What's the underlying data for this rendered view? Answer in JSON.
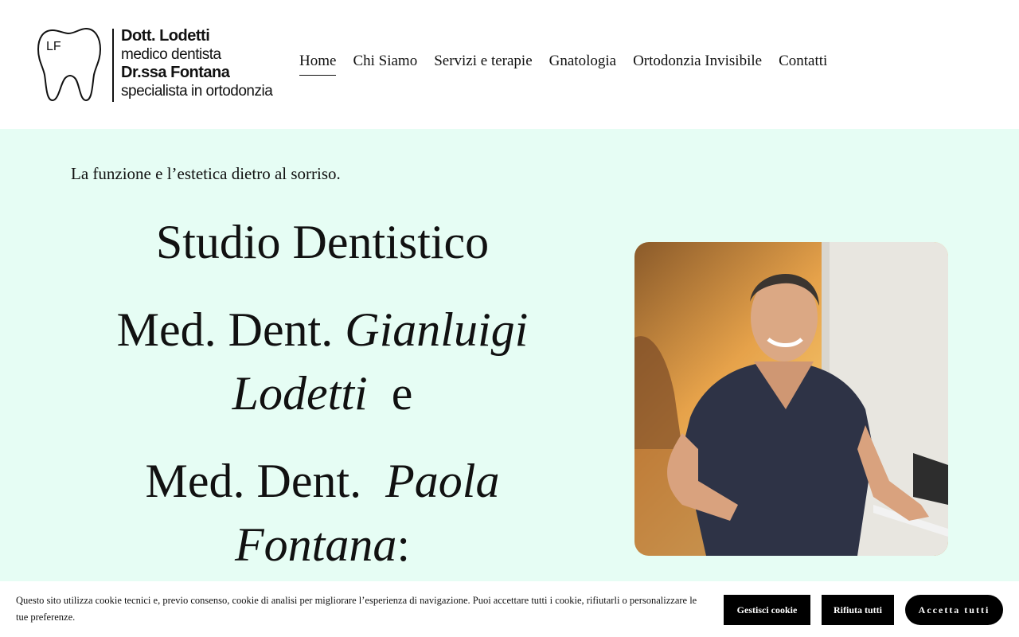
{
  "header": {
    "logo": {
      "monogram": "LF",
      "lines": [
        "Dott. Lodetti",
        "medico dentista",
        "Dr.ssa Fontana",
        "specialista in ortodonzia"
      ]
    },
    "nav": [
      {
        "label": "Home",
        "active": true
      },
      {
        "label": "Chi Siamo"
      },
      {
        "label": "Servizi e terapie"
      },
      {
        "label": "Gnatologia"
      },
      {
        "label": "Ortodonzia Invisibile"
      },
      {
        "label": "Contatti"
      }
    ]
  },
  "hero": {
    "tagline": "La funzione e l’estetica dietro al sorriso.",
    "title": "Studio Dentistico",
    "doctor1_prefix": "Med. Dent.",
    "doctor1_first": "Gianluigi",
    "doctor1_last": "Lodetti",
    "connector": "e",
    "doctor2_prefix": "Med. Dent.",
    "doctor2_first": "Paola",
    "doctor2_last": "Fontana",
    "doctor2_suffix": ":",
    "background_color": "#e6fdf4"
  },
  "cookie_banner": {
    "text": "Questo sito utilizza cookie tecnici e, previo consenso, cookie di analisi per migliorare l’esperienza di navigazione.  Puoi accettare tutti i cookie, rifiutarli o personalizzare le tue preferenze.",
    "manage_label": "Gestisci cookie",
    "reject_label": "Rifiuta tutti",
    "accept_label": "Accetta tutti"
  }
}
